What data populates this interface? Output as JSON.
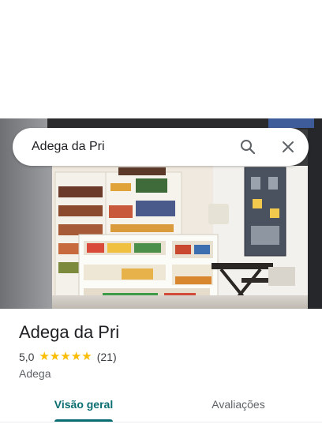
{
  "search": {
    "query": "Adega da Pri",
    "search_icon": "search-icon",
    "close_icon": "close-icon"
  },
  "place": {
    "name": "Adega da Pri",
    "rating": "5,0",
    "stars": 5,
    "review_count": "(21)",
    "category": "Adega"
  },
  "tabs": [
    {
      "label": "Visão geral",
      "active": true
    },
    {
      "label": "Avaliações",
      "active": false
    }
  ],
  "colors": {
    "accent": "#0b6e72",
    "star": "#fbbc04"
  }
}
